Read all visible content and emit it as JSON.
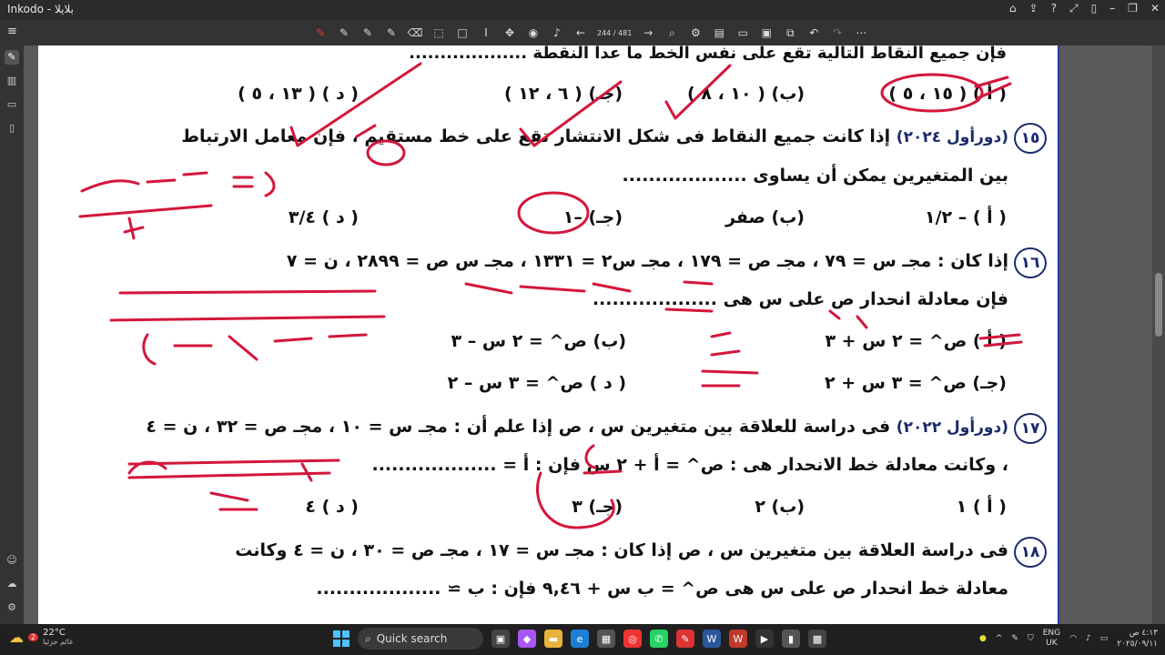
{
  "window": {
    "title": "Inkodo - بلايلا"
  },
  "toolbar": {
    "page_counter": "244 / 481"
  },
  "document": {
    "top_line": "فإن جميع النقاط التالية تقع على نفس الخط ما عدا النقطة ...................",
    "q14_options": [
      "( أ ) ( ١٥ ، ٥ )",
      "(ب) ( ١٠ ، ٨ )",
      "(جـ) ( ٦ ، ١٢ )",
      "( د ) ( ١٣ ، ٥ )"
    ],
    "q15": {
      "num": "١٥",
      "tag": "(دورأول ٢٠٢٤)",
      "text1": "إذا كانت جميع النقاط فى شكل الانتشار تقع على خط مستقيم ، فإن معامل الارتباط",
      "text2": "بين المتغيرين يمكن أن يساوى ...................",
      "options": [
        "( أ ) – ١/٢",
        "(ب) صفر",
        "(جـ) –١",
        "( د ) ٣/٤"
      ]
    },
    "q16": {
      "num": "١٦",
      "text1": "إذا كان : مجـ س = ٧٩ ، مجـ ص = ١٧٩ ، مجـ س٢ = ١٣٣١ ، مجـ س ص = ٢٨٩٩ ، ن = ٧",
      "text2": "فإن معادلة انحدار ص على س هى ...................",
      "options": [
        "( أ ) ص^ = ٢ س + ٣",
        "(ب) ص^ = ٢ س – ٣",
        "(جـ) ص^ = ٣ س + ٢",
        "( د ) ص^ = ٣ س – ٢"
      ]
    },
    "q17": {
      "num": "١٧",
      "tag": "(دورأول ٢٠٢٢)",
      "text1": "فى دراسة للعلاقة بين متغيرين س ، ص إذا علم أن : مجـ س = ١٠ ، مجـ ص = ٣٢ ، ن = ٤",
      "text2": "، وكانت معادلة خط الانحدار هى : ص^ = أ + ٢ س         فإن : أ = ...................",
      "options": [
        "( أ ) ١",
        "(ب) ٢",
        "(جـ) ٣",
        "( د ) ٤"
      ]
    },
    "q18": {
      "num": "١٨",
      "text1": "فى دراسة العلاقة بين متغيرين س ، ص إذا كان : مجـ س = ١٧ ، مجـ ص = ٣٠ ، ن = ٤ وكانت",
      "text2": "معادلة خط انحدار ص على س هى ص^ = ب س + ٩,٤٦      فإن : ب ≃ ..................."
    }
  },
  "taskbar": {
    "weather_temp": "22°C",
    "weather_desc": "غائم جزئيا",
    "weather_badge": "2",
    "search_label": "Quick search",
    "lang": "ENG",
    "region": "UK",
    "time": "٤:١٣ ص",
    "date": "٢٠٢٥/٠٩/١١"
  }
}
